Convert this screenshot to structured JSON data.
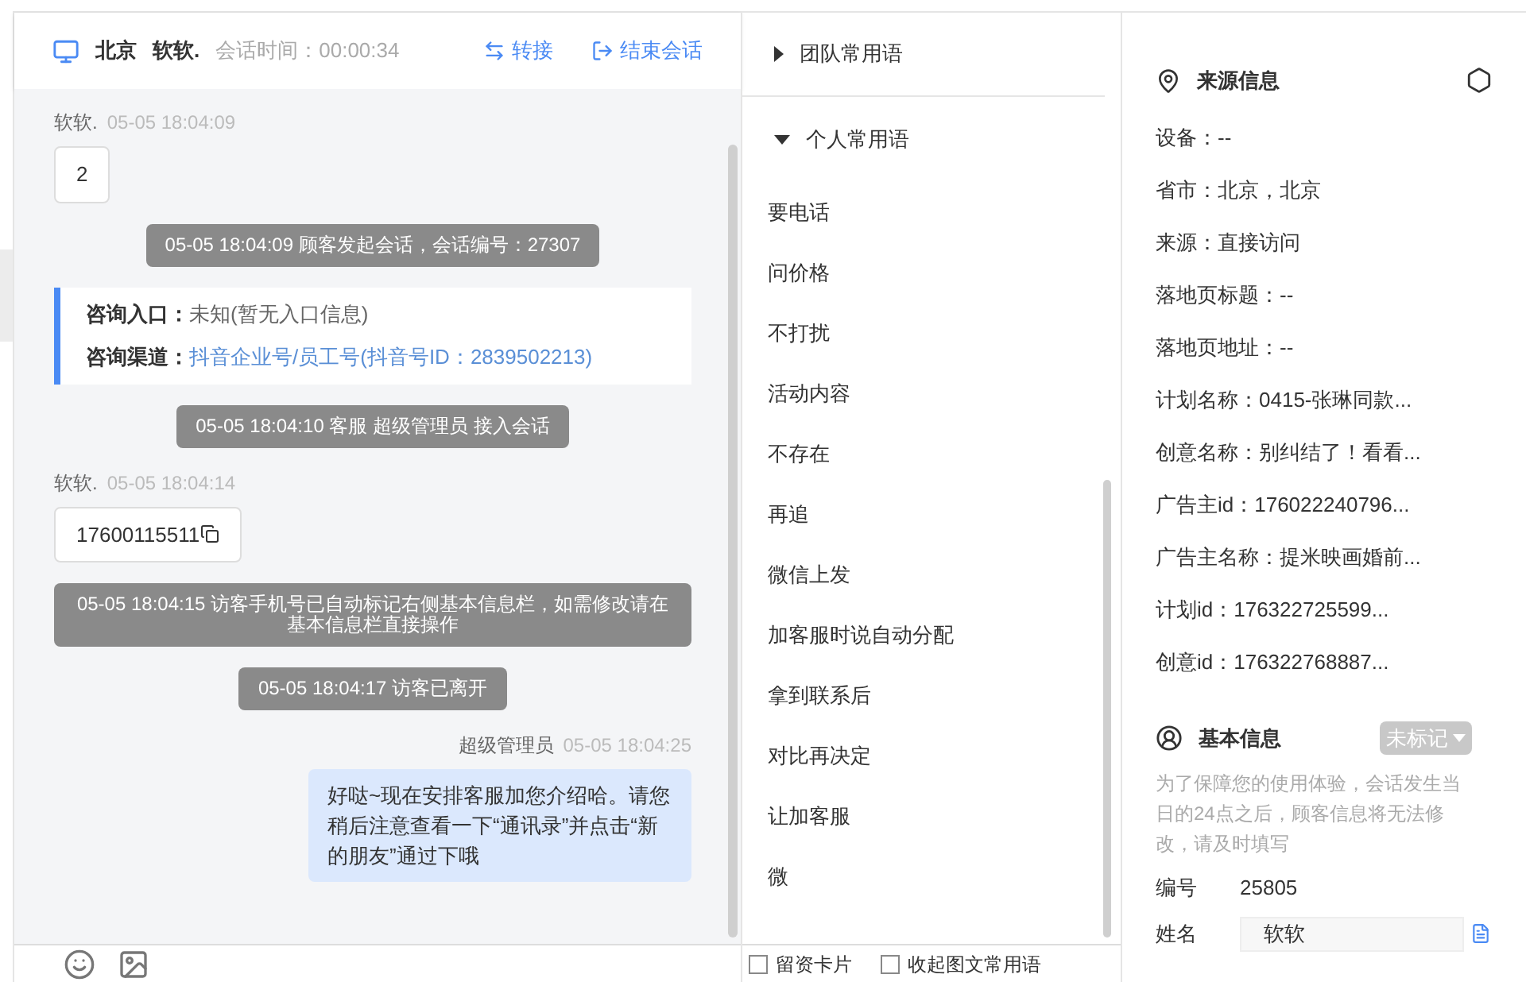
{
  "header": {
    "city": "北京",
    "visitor": "软软.",
    "duration": "会话时间：00:00:34",
    "actions": [
      {
        "kind": "transfer",
        "label": "转接"
      },
      {
        "kind": "end",
        "label": "结束会话"
      }
    ]
  },
  "messages": [
    {
      "kind": "visitor",
      "sender": "软软.",
      "time": "05-05 18:04:09",
      "text": "2",
      "copyable": false
    },
    {
      "kind": "system",
      "text": "05-05 18:04:09 顾客发起会话，会话编号：27307"
    },
    {
      "kind": "info",
      "rows": [
        {
          "label": "咨询入口：",
          "value": "未知(暂无入口信息)",
          "link": false
        },
        {
          "label": "咨询渠道：",
          "value": "抖音企业号/员工号(抖音号ID：2839502213)",
          "link": true
        }
      ]
    },
    {
      "kind": "system",
      "text": "05-05 18:04:10 客服 超级管理员 接入会话"
    },
    {
      "kind": "visitor",
      "sender": "软软.",
      "time": "05-05 18:04:14",
      "text": "17600115511",
      "copyable": true
    },
    {
      "kind": "system",
      "text": "05-05 18:04:15 访客手机号已自动标记右侧基本信息栏，如需修改请在基本信息栏直接操作"
    },
    {
      "kind": "system",
      "text": "05-05 18:04:17 访客已离开"
    },
    {
      "kind": "agent",
      "sender": "超级管理员",
      "time": "05-05 18:04:25",
      "text": "好哒~现在安排客服加您介绍哈。请您稍后注意查看一下“通讯录”并点击“新的朋友”通过下哦"
    }
  ],
  "phrases": {
    "groups": [
      {
        "title": "团队常用语",
        "expanded": false
      },
      {
        "title": "个人常用语",
        "expanded": true
      }
    ],
    "items": [
      "要电话",
      "问价格",
      "不打扰",
      "活动内容",
      "不存在",
      "再追",
      "微信上发",
      "加客服时说自动分配",
      "拿到联系后",
      "对比再决定",
      "让加客服",
      "微"
    ],
    "options": [
      {
        "label": "留资卡片",
        "checked": false
      },
      {
        "label": "收起图文常用语",
        "checked": false
      }
    ]
  },
  "source": {
    "title": "来源信息",
    "rows": [
      "设备：--",
      "省市：北京，北京",
      "来源：直接访问",
      "落地页标题：--",
      "落地页地址：--",
      "计划名称：0415-张琳同款...",
      "创意名称：别纠结了！看看...",
      "广告主id：176022240796...",
      "广告主名称：提米映画婚前...",
      "计划id：176322725599...",
      "创意id：176322768887..."
    ]
  },
  "basic": {
    "title": "基本信息",
    "tag": "未标记",
    "note": "为了保障您的使用体验，会话发生当日的24点之后，顾客信息将无法修改，请及时填写",
    "fields": [
      {
        "kind": "text",
        "label": "编号",
        "value": "25805"
      },
      {
        "kind": "input",
        "label": "姓名",
        "value": "软软"
      }
    ]
  }
}
